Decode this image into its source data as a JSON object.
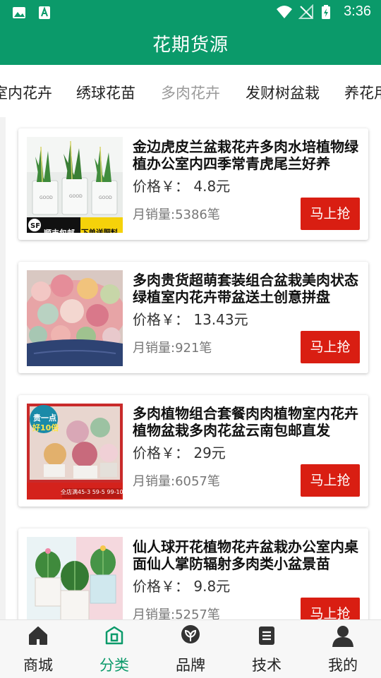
{
  "status_bar": {
    "time": "3:36"
  },
  "app_bar": {
    "title": "花期货源"
  },
  "tabs": [
    {
      "label": "室内花卉"
    },
    {
      "label": "绣球花苗"
    },
    {
      "label": "多肉花卉"
    },
    {
      "label": "发财树盆栽"
    },
    {
      "label": "养花用"
    }
  ],
  "active_tab_index": 2,
  "products": [
    {
      "title": "金边虎皮兰盆栽花卉多肉水培植物绿植办公室内四季常青虎尾兰好养",
      "price": "价格￥： 4.8元",
      "sales": "月销量:5386笔",
      "buy_label": "马上抢",
      "badge_left": "顺丰包邮",
      "badge_right": "下单送肥料"
    },
    {
      "title": "多肉贵货超萌套装组合盆栽美肉状态绿植室内花卉带盆送土创意拼盘",
      "price": "价格￥： 13.43元",
      "sales": "月销量:921笔",
      "buy_label": "马上抢"
    },
    {
      "title": "多肉植物组合套餐肉肉植物室内花卉植物盆栽多肉花盆云南包邮直发",
      "price": "价格￥： 29元",
      "sales": "月销量:6057笔",
      "buy_label": "马上抢",
      "badge_top1": "贵一点",
      "badge_top2": "好10倍",
      "badge_bottom": "全店满45-3 59-5 99-10"
    },
    {
      "title": "仙人球开花植物花卉盆栽办公室内桌面仙人掌防辐射多肉类小盆景苗",
      "price": "价格￥： 9.8元",
      "sales": "月销量:5257笔",
      "buy_label": "马上抢"
    }
  ],
  "bottom_nav": [
    {
      "label": "商城",
      "icon": "home-icon"
    },
    {
      "label": "分类",
      "icon": "category-icon"
    },
    {
      "label": "品牌",
      "icon": "brand-icon"
    },
    {
      "label": "技术",
      "icon": "document-icon"
    },
    {
      "label": "我的",
      "icon": "person-icon"
    }
  ],
  "colors": {
    "primary": "#0b9a6a",
    "buy_button": "#d91e12"
  }
}
